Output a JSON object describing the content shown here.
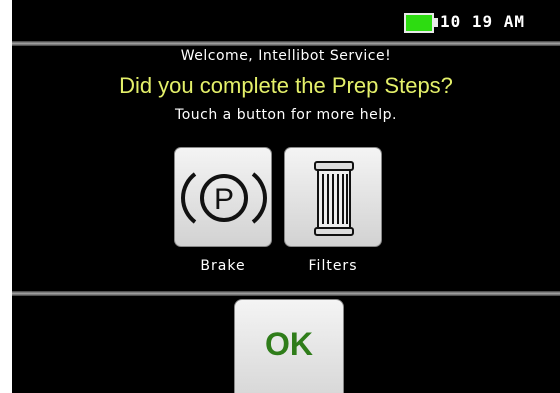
{
  "status_bar": {
    "time": "10 19 AM",
    "battery_icon": "battery-full-icon",
    "battery_color": "#2ddc11"
  },
  "prompt": {
    "welcome": "Welcome, Intellibot Service!",
    "question": "Did you complete the Prep Steps?",
    "hint": "Touch a button for more help.",
    "question_color": "#e4f06a"
  },
  "buttons": {
    "brake": {
      "label": "Brake",
      "icon": "parking-brake-icon",
      "icon_text": "P"
    },
    "filters": {
      "label": "Filters",
      "icon": "filter-cartridge-icon"
    },
    "ok": {
      "label": "OK",
      "color": "#2f7d1a"
    }
  }
}
